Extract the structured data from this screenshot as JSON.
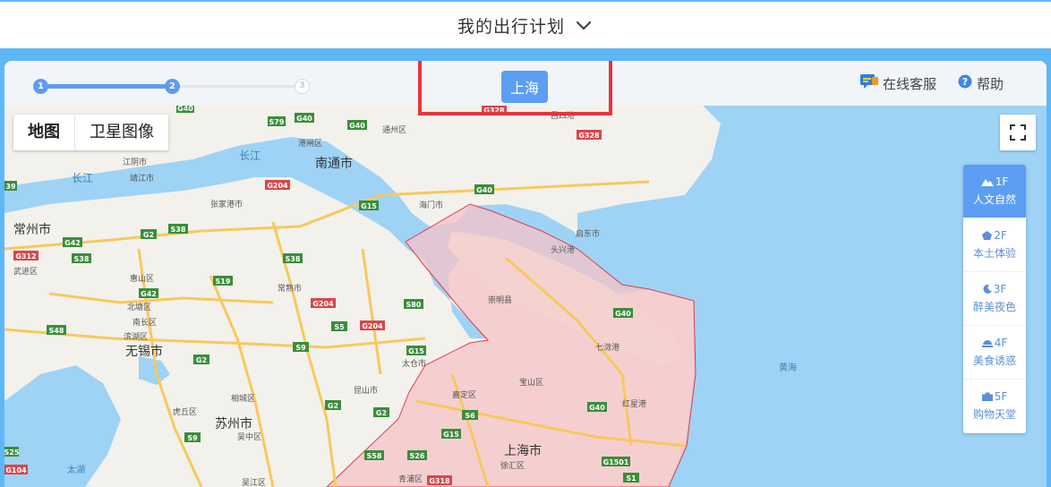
{
  "header": {
    "title": "我的出行计划"
  },
  "steps": [
    "1",
    "2",
    "3"
  ],
  "city": {
    "label": "上海"
  },
  "links": {
    "service": "在线客服",
    "help": "帮助"
  },
  "map": {
    "type_map": "地图",
    "type_satellite": "卫星图像",
    "labels": {
      "jiangyin": "江阴市",
      "jingjiang": "靖江市",
      "zhangjiagang": "张家港市",
      "changjiang1": "长江",
      "changjiang2": "长江",
      "changzhou": "常州市",
      "wujin": "武进区",
      "huishan": "惠山区",
      "beitang": "北塘区",
      "nanchang": "南长区",
      "binhu": "滨湖区",
      "wuxi": "无锡市",
      "changshu": "常熟市",
      "xiangcheng": "相城区",
      "huqiu": "虎丘区",
      "suzhou": "苏州市",
      "wuzhong": "吴中区",
      "kunshan": "昆山市",
      "taicang": "太仓市",
      "nantong": "南通市",
      "gangzha": "港闸区",
      "tongzhou": "通州区",
      "haimen": "海门市",
      "qidong": "启东市",
      "lvsi": "吕四港",
      "toutuo": "头兴港",
      "chongming": "崇明县",
      "qihao": "七滧港",
      "hongxing": "红星港",
      "baoshan": "宝山区",
      "jiading": "嘉定区",
      "shanghai": "上海市",
      "xuhui": "徐汇区",
      "qingpu": "青浦区",
      "wujiang": "吴江区",
      "huanghai": "黄海",
      "taihu": "太湖"
    },
    "shields": {
      "g40a": "G40",
      "s79": "S79",
      "g40b": "G40",
      "g40c": "G40",
      "g328a": "G328",
      "g328b": "G328",
      "s39": "39",
      "g204a": "G204",
      "g15a": "G15",
      "g40d": "G40",
      "s38a": "S38",
      "g2a": "G2",
      "g42a": "G42",
      "s38b": "S38",
      "g312": "G312",
      "s38c": "S38",
      "s19": "S19",
      "g42b": "G42",
      "g204b": "G204",
      "s80": "S80",
      "s48": "S48",
      "s5": "S5",
      "g204c": "G204",
      "s9a": "S9",
      "g15b": "G15",
      "g40e": "G40",
      "g2b": "G2",
      "s9b": "S9",
      "g2c": "G2",
      "g2d": "G2",
      "s6": "S6",
      "g15c": "G15",
      "g40f": "G40",
      "s58": "S58",
      "s26": "S26",
      "g318": "G318",
      "g1501": "G1501",
      "s1": "S1",
      "s25": "S25",
      "g104": "G104"
    }
  },
  "floors": [
    {
      "level": "1F",
      "name": "人文自然",
      "icon": "mountain-icon"
    },
    {
      "level": "2F",
      "name": "本土体验",
      "icon": "pentagon-icon"
    },
    {
      "level": "3F",
      "name": "醉美夜色",
      "icon": "moon-icon"
    },
    {
      "level": "4F",
      "name": "美食诱惑",
      "icon": "dish-icon"
    },
    {
      "level": "5F",
      "name": "购物天堂",
      "icon": "bag-icon"
    }
  ],
  "colors": {
    "accent": "#5b9ef4",
    "sky": "#5eb7f7",
    "water": "#9ed3f5",
    "land": "#f3f1ec",
    "region": "#f6c3c7",
    "highlight": "#e8343f"
  }
}
